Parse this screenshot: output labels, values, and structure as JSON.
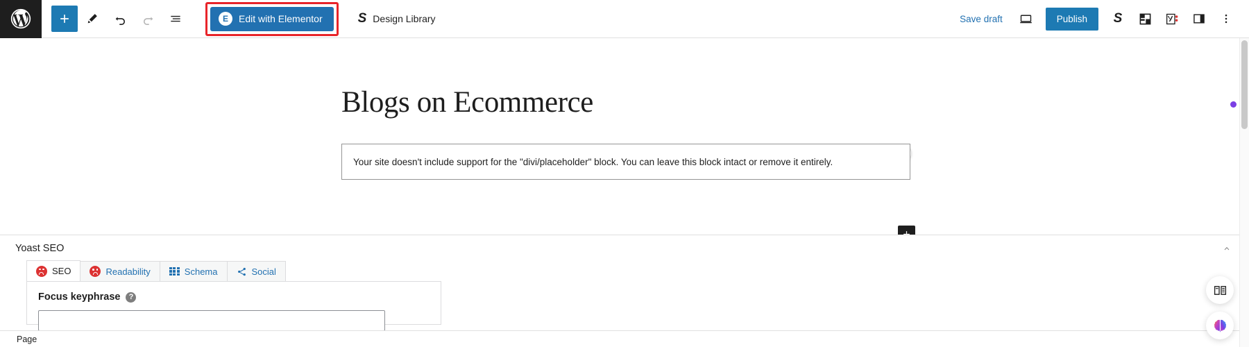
{
  "topbar": {
    "wp_logo_name": "wordpress-logo",
    "left_tools": [
      {
        "name": "block-inserter-button",
        "label": "Add block",
        "icon": "plus-icon",
        "state": "primary"
      },
      {
        "name": "edit-tool-button",
        "label": "Tools",
        "icon": "pencil-icon",
        "state": "normal"
      },
      {
        "name": "undo-button",
        "label": "Undo",
        "icon": "undo-arrow-icon",
        "state": "normal"
      },
      {
        "name": "redo-button",
        "label": "Redo",
        "icon": "redo-arrow-icon",
        "state": "disabled"
      },
      {
        "name": "document-overview-button",
        "label": "Document Overview",
        "icon": "list-view-icon",
        "state": "normal"
      }
    ],
    "elementor_button": {
      "label": "Edit with Elementor",
      "badge": "E",
      "highlighted": true,
      "highlight_color": "#e8242a",
      "bg_color": "#2271b1"
    },
    "design_library": {
      "label": "Design Library",
      "icon": "stackable-s-icon"
    },
    "save_draft_label": "Save draft",
    "preview_icon_name": "preview-laptop-icon",
    "publish_label": "Publish",
    "publish_color": "#1d7ab3",
    "right_icons": [
      {
        "name": "stackable-icon",
        "label": "Stackable"
      },
      {
        "name": "grid-blocks-icon",
        "label": "Blocks"
      },
      {
        "name": "yoast-seo-icon",
        "label": "Yoast SEO"
      },
      {
        "name": "settings-sidebar-icon",
        "label": "Settings"
      },
      {
        "name": "options-kebab-icon",
        "label": "Options"
      }
    ]
  },
  "canvas": {
    "post_title": "Blogs on Ecommerce",
    "grammarly_badge": {
      "name": "grammarly-badge",
      "lightbulb_color": "#15a88a",
      "logo_color": "#15806a"
    },
    "placeholder_block": {
      "message": "Your site doesn't include support for the \"divi/placeholder\" block. You can leave this block intact or remove it entirely."
    },
    "block_appender_label": "Add block"
  },
  "yoast": {
    "panel_title": "Yoast SEO",
    "collapse_icon": "chevron-up-icon",
    "tabs": [
      {
        "label": "SEO",
        "icon": "seo-score-face-icon",
        "active": true
      },
      {
        "label": "Readability",
        "icon": "readability-score-face-icon",
        "active": false
      },
      {
        "label": "Schema",
        "icon": "schema-grid-icon",
        "active": false
      },
      {
        "label": "Social",
        "icon": "social-share-icon",
        "active": false
      }
    ],
    "focus_keyphrase": {
      "label": "Focus keyphrase",
      "help_icon": "help-question-icon",
      "value": "",
      "placeholder": ""
    }
  },
  "statusbar": {
    "label": "Page"
  },
  "floating": [
    {
      "name": "reader-book-button",
      "icon": "open-book-icon"
    },
    {
      "name": "ai-assistant-button",
      "icon": "brain-icon"
    }
  ],
  "scroll": {
    "indicator_color": "#7b3fe4"
  }
}
